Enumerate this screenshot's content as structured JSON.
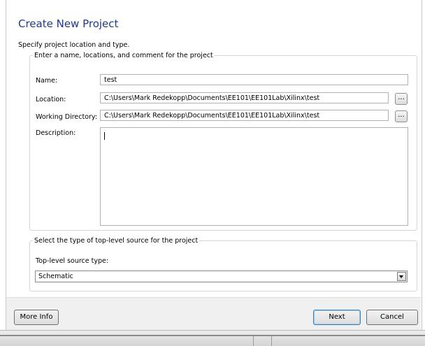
{
  "window": {
    "title": "Create New Project",
    "subtitle": "Specify project location and type."
  },
  "project_group": {
    "legend": "Enter a name, locations, and comment for the project",
    "name_label": "Name:",
    "name_value": "test",
    "location_label": "Location:",
    "location_value": "C:\\Users\\Mark Redekopp\\Documents\\EE101\\EE101Lab\\Xilinx\\test",
    "working_dir_label": "Working Directory:",
    "working_dir_value": "C:\\Users\\Mark Redekopp\\Documents\\EE101\\EE101Lab\\Xilinx\\test",
    "browse_label": "...",
    "description_label": "Description:",
    "description_value": ""
  },
  "source_group": {
    "legend": "Select the type of top-level source for the project",
    "type_label": "Top-level source type:",
    "type_value": "Schematic"
  },
  "footer": {
    "more_info_label": "More Info",
    "next_label": "Next",
    "cancel_label": "Cancel"
  }
}
